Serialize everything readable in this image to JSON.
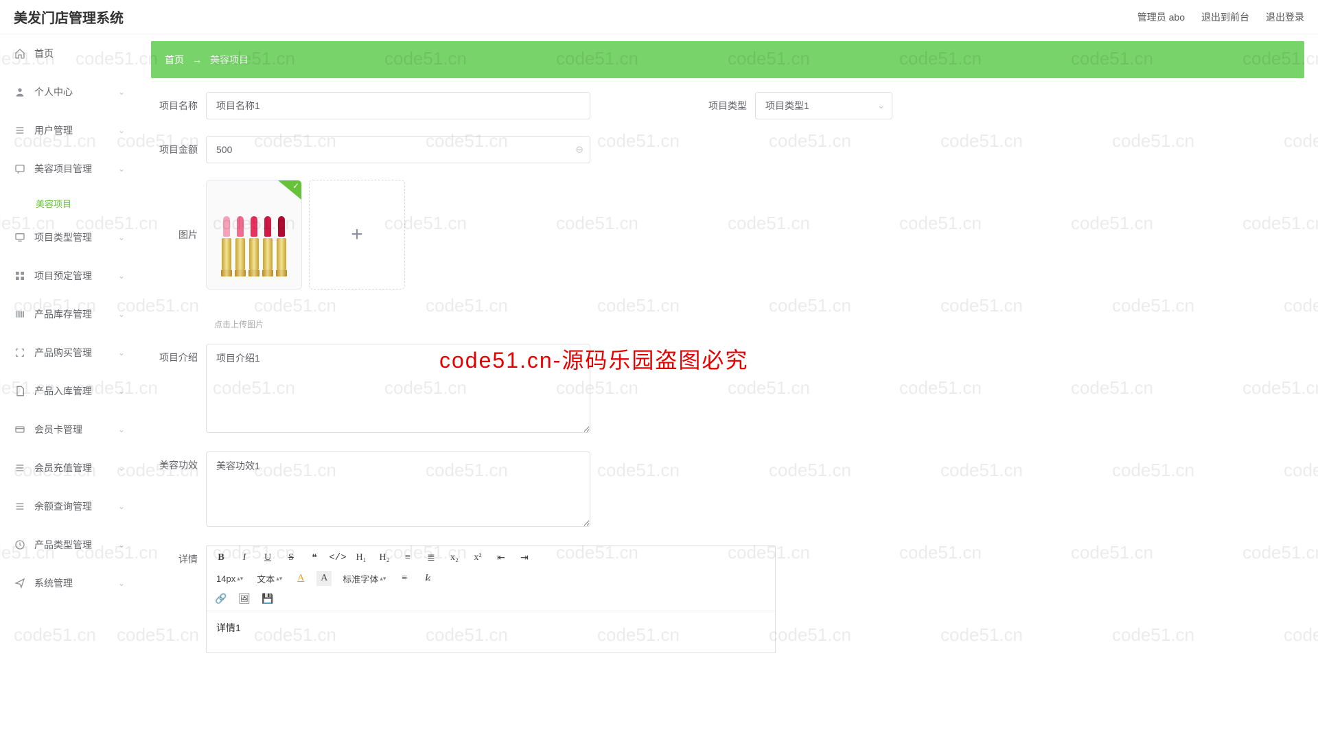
{
  "header": {
    "title": "美发门店管理系统",
    "admin_label": "管理员 abo",
    "exit_front_label": "退出到前台",
    "logout_label": "退出登录"
  },
  "sidebar": {
    "items": [
      {
        "label": "首页"
      },
      {
        "label": "个人中心"
      },
      {
        "label": "用户管理"
      },
      {
        "label": "美容项目管理",
        "sub": "美容项目"
      },
      {
        "label": "项目类型管理"
      },
      {
        "label": "项目预定管理"
      },
      {
        "label": "产品库存管理"
      },
      {
        "label": "产品购买管理"
      },
      {
        "label": "产品入库管理"
      },
      {
        "label": "会员卡管理"
      },
      {
        "label": "会员充值管理"
      },
      {
        "label": "余额查询管理"
      },
      {
        "label": "产品类型管理"
      },
      {
        "label": "系统管理"
      }
    ]
  },
  "breadcrumb": {
    "home": "首页",
    "sep": "→",
    "current": "美容项目"
  },
  "form": {
    "name_label": "项目名称",
    "name_value": "项目名称1",
    "type_label": "项目类型",
    "type_value": "项目类型1",
    "amount_label": "项目金额",
    "amount_value": "500",
    "image_label": "图片",
    "upload_hint": "点击上传图片",
    "intro_label": "项目介绍",
    "intro_value": "项目介绍1",
    "effect_label": "美容功效",
    "effect_value": "美容功效1",
    "detail_label": "详情",
    "detail_value": "详情1"
  },
  "editor": {
    "font_size": "14px",
    "text_btn": "文本",
    "font_family": "标准字体"
  },
  "watermark": {
    "big": "code51.cn-源码乐园盗图必究",
    "small": "code51.cn"
  },
  "lip_colors": [
    "#f5a3b8",
    "#f06c8f",
    "#e8325e",
    "#d11a45",
    "#b0082e"
  ]
}
